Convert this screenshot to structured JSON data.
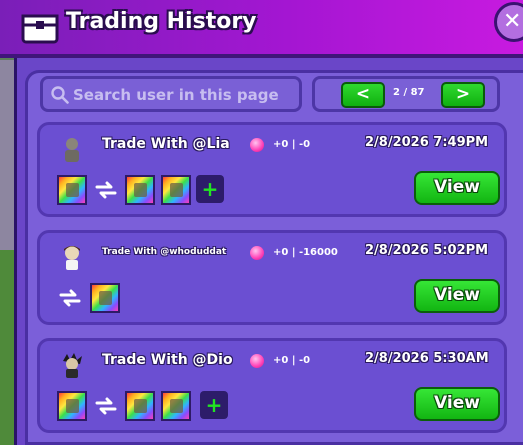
{
  "header": {
    "title": "Trading History"
  },
  "search": {
    "placeholder": "Search user in this page"
  },
  "pager": {
    "prev_label": "<",
    "next_label": ">",
    "page_label": "2 / 87"
  },
  "colors": {
    "accent_purple": "#a416d2",
    "view_green": "#12b512",
    "gem_pink": "#ff3fb6"
  },
  "trades": [
    {
      "title": "Trade With @Lia",
      "delta": "+0 | -0",
      "date": "2/8/2026 7:49PM",
      "view_label": "View",
      "add_symbol": "+"
    },
    {
      "title": "Trade With @whoduddat",
      "delta": "+0 | -16000",
      "date": "2/8/2026 5:02PM",
      "view_label": "View"
    },
    {
      "title": "Trade With @Dio",
      "delta": "+0 | -0",
      "date": "2/8/2026 5:30AM",
      "view_label": "View",
      "add_symbol": "+"
    }
  ]
}
